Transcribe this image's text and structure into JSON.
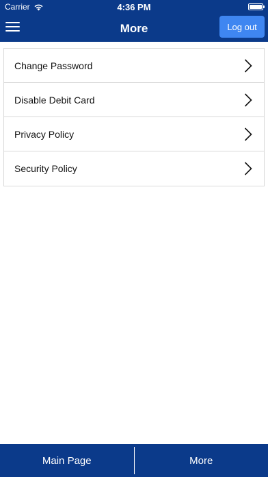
{
  "status_bar": {
    "carrier": "Carrier",
    "time": "4:36 PM",
    "icons": [
      "wifi-icon",
      "battery-icon"
    ]
  },
  "nav": {
    "title": "More",
    "menu_icon": "hamburger-menu-icon",
    "logout_label": "Log out"
  },
  "menu": {
    "items": [
      {
        "label": "Change Password",
        "icon": "chevron-right-icon"
      },
      {
        "label": "Disable Debit Card",
        "icon": "chevron-right-icon"
      },
      {
        "label": "Privacy Policy",
        "icon": "chevron-right-icon"
      },
      {
        "label": "Security Policy",
        "icon": "chevron-right-icon"
      }
    ]
  },
  "tabbar": {
    "tabs": [
      {
        "label": "Main Page"
      },
      {
        "label": "More"
      }
    ]
  },
  "colors": {
    "primary": "#0b3a8a",
    "button": "#3f86f1",
    "border": "#d9d9d9"
  }
}
